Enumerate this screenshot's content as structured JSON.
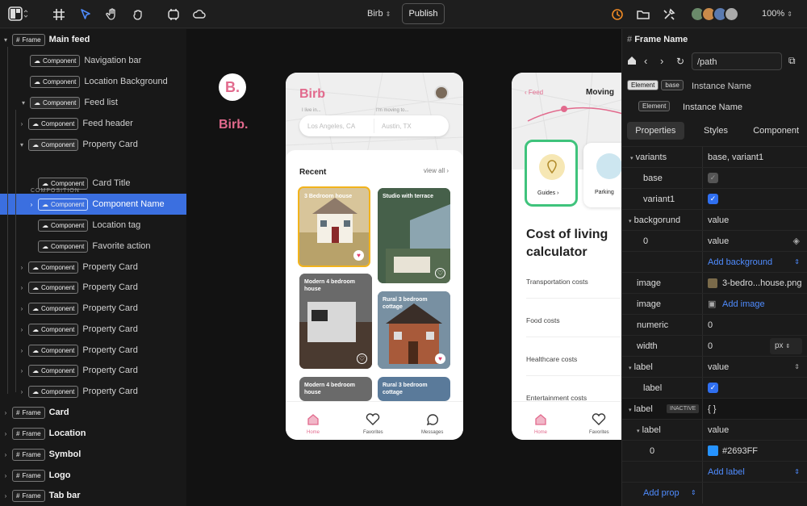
{
  "toolbar": {
    "project": "Birb",
    "publish": "Publish",
    "zoom": "100%"
  },
  "layers": [
    {
      "label": "Main feed",
      "badge": "Frame",
      "indent": 0,
      "caret": "▾",
      "bold": true
    },
    {
      "label": "Navigation bar",
      "badge": "Component",
      "indent": 1,
      "caret": ""
    },
    {
      "label": "Location Background",
      "badge": "Component",
      "indent": 1,
      "caret": ""
    },
    {
      "label": "Feed list",
      "badge": "Component",
      "indent": 1,
      "caret": "▾",
      "hl": true
    },
    {
      "label": "Feed header",
      "badge": "Component",
      "indent": 2,
      "caret": "›"
    },
    {
      "label": "Property Card",
      "badge": "Component",
      "indent": 2,
      "caret": "▾",
      "hl": true
    },
    {
      "label": "Card Title",
      "badge": "Component",
      "indent": 3,
      "caret": ""
    },
    {
      "label": "Component Name",
      "badge": "Component",
      "indent": 3,
      "caret": "›",
      "sel": true
    },
    {
      "label": "Location tag",
      "badge": "Component",
      "indent": 3,
      "caret": ""
    },
    {
      "label": "Favorite action",
      "badge": "Component",
      "indent": 3,
      "caret": ""
    },
    {
      "label": "Property Card",
      "badge": "Component",
      "indent": 2,
      "caret": "›"
    },
    {
      "label": "Property Card",
      "badge": "Component",
      "indent": 2,
      "caret": "›"
    },
    {
      "label": "Property Card",
      "badge": "Component",
      "indent": 2,
      "caret": "›"
    },
    {
      "label": "Property Card",
      "badge": "Component",
      "indent": 2,
      "caret": "›"
    },
    {
      "label": "Property Card",
      "badge": "Component",
      "indent": 2,
      "caret": "›"
    },
    {
      "label": "Property Card",
      "badge": "Component",
      "indent": 2,
      "caret": "›"
    },
    {
      "label": "Property Card",
      "badge": "Component",
      "indent": 2,
      "caret": "›"
    },
    {
      "label": "Card",
      "badge": "Frame",
      "indent": 0,
      "caret": "›",
      "bold": true
    },
    {
      "label": "Location",
      "badge": "Frame",
      "indent": 0,
      "caret": "›",
      "bold": true
    },
    {
      "label": "Symbol",
      "badge": "Frame",
      "indent": 0,
      "caret": "›",
      "bold": true
    },
    {
      "label": "Logo",
      "badge": "Frame",
      "indent": 0,
      "caret": "›",
      "bold": true
    },
    {
      "label": "Tab bar",
      "badge": "Frame",
      "indent": 0,
      "caret": "›",
      "bold": true
    }
  ],
  "composition_label": "COMPOSITION",
  "canvas": {
    "logo_letter": "B.",
    "logo_text": "Birb.",
    "phone1": {
      "title": "Birb",
      "live_in_label": "I live in...",
      "moving_to_label": "I'm moving to...",
      "live_in": "Los Angeles, CA",
      "moving_to": "Austin, TX",
      "recent": "Recent",
      "view_all": "view all",
      "cards": [
        "3 Bedroom house",
        "Studio with terrace",
        "Modern 4 bedroom house",
        "Rural 3 bedroom cottage",
        "Modern 4 bedroom house",
        "Rural 3 bedroom cottage"
      ],
      "tabs": [
        "Home",
        "Favorites",
        "Messages"
      ]
    },
    "phone2": {
      "back": "Feed",
      "title": "Moving",
      "guides": "Guides",
      "parking": "Parking",
      "calc_title": "Cost of living calculator",
      "costs": [
        "Transportation costs",
        "Food costs",
        "Healthcare costs",
        "Entertainment costs"
      ],
      "tabs": [
        "Home",
        "Favorites"
      ]
    }
  },
  "inspector": {
    "frame_name": "Frame Name",
    "path": "/path",
    "element_badge": "Element",
    "base_badge": "base",
    "instance_name": "Instance Name",
    "instance_name2": "Instance Name",
    "tabs": [
      "Properties",
      "Styles",
      "Component"
    ],
    "rows": {
      "variants": "variants",
      "variants_val": "base, variant1",
      "base": "base",
      "variant1": "variant1",
      "background": "backgorund",
      "background_val": "value",
      "bg0": "0",
      "bg0_val": "value",
      "add_background": "Add background",
      "image": "image",
      "image_val": "3-bedro...house.png",
      "image2": "image",
      "add_image": "Add image",
      "numeric": "numeric",
      "numeric_val": "0",
      "width": "width",
      "width_val": "0",
      "width_unit": "px",
      "label": "label",
      "label_val": "value",
      "label_sub": "label",
      "label2": "label",
      "inactive": "INACTIVE",
      "label2_val": "{ }",
      "label3": "label",
      "label3_val": "value",
      "color_idx": "0",
      "color_val": "#2693FF",
      "add_label": "Add label",
      "add_prop": "Add prop"
    }
  },
  "colors": {
    "accent": "#3b6fe0",
    "brand": "#e26a8d",
    "swatch": "#2693FF"
  }
}
